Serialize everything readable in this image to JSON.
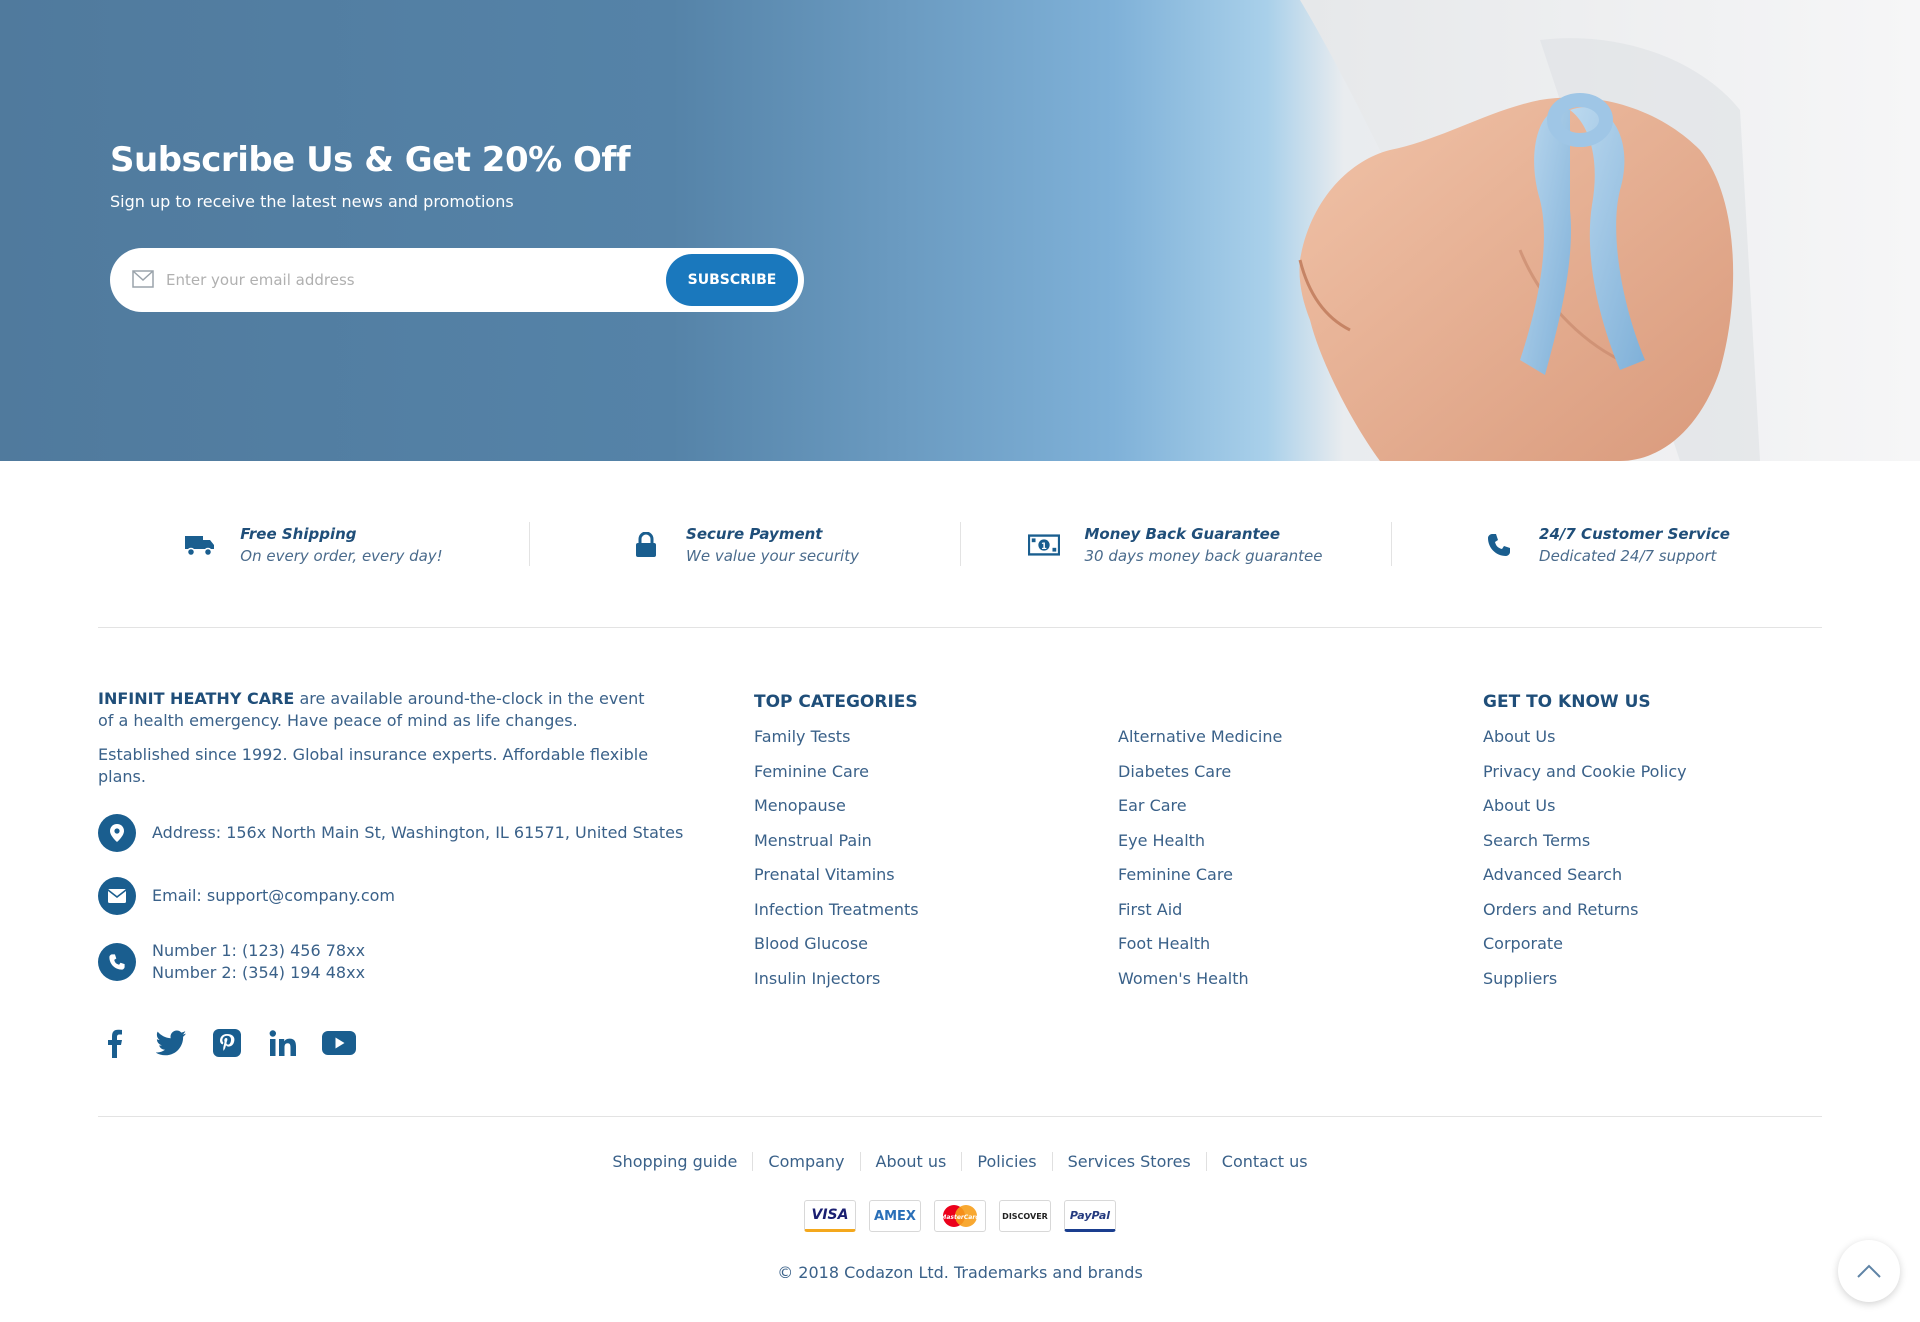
{
  "banner": {
    "title": "Subscribe Us & Get 20% Off",
    "subtitle": "Sign up to receive the latest news and promotions",
    "email_placeholder": "Enter your email address",
    "subscribe_label": "SUBSCRIBE"
  },
  "features": [
    {
      "icon": "truck-icon",
      "title": "Free Shipping",
      "desc": "On every order, every day!"
    },
    {
      "icon": "lock-icon",
      "title": "Secure Payment",
      "desc": "We value your security"
    },
    {
      "icon": "money-icon",
      "title": "Money Back Guarantee",
      "desc": "30 days money back guarantee"
    },
    {
      "icon": "phone-icon",
      "title": "24/7 Customer Service",
      "desc": "Dedicated 24/7 support"
    }
  ],
  "about": {
    "brand": "INFINIT HEATHY CARE",
    "text1": " are available around-the-clock in the event of a health emergency. Have peace of mind as life changes.",
    "text2": "Established since 1992. Global insurance experts. Affordable flexible plans.",
    "address": "Address: 156x North Main St, Washington, IL 61571, United States",
    "email": "Email: support@company.com",
    "phone1": "Number 1: (123) 456 78xx",
    "phone2": "Number 2: (354) 194 48xx"
  },
  "socials": [
    "facebook-icon",
    "twitter-icon",
    "pinterest-icon",
    "linkedin-icon",
    "youtube-icon"
  ],
  "top_categories": {
    "title": "TOP CATEGORIES",
    "col1": [
      "Family Tests",
      "Feminine Care",
      "Menopause",
      "Menstrual Pain",
      "Prenatal Vitamins",
      "Infection Treatments",
      "Blood Glucose",
      "Insulin Injectors"
    ],
    "col2": [
      "Alternative Medicine",
      "Diabetes Care",
      "Ear Care",
      "Eye Health",
      "Feminine Care",
      "First Aid",
      "Foot Health",
      "Women's Health"
    ]
  },
  "get_to_know": {
    "title": "GET TO KNOW US",
    "links": [
      "About Us",
      "Privacy and Cookie Policy",
      "About Us",
      "Search Terms",
      "Advanced Search",
      "Orders and Returns",
      "Corporate",
      "Suppliers"
    ]
  },
  "bottom_links": [
    "Shopping guide",
    "Company",
    "About us",
    "Policies",
    "Services Stores",
    "Contact us"
  ],
  "payments": [
    "VISA",
    "AMEX",
    "MasterCard",
    "DISCOVER",
    "PayPal"
  ],
  "copyright": "© 2018 Codazon Ltd. Trademarks and brands",
  "colors": {
    "primary": "#1f4e79",
    "accent": "#1a78bd",
    "link": "#3a6189"
  }
}
